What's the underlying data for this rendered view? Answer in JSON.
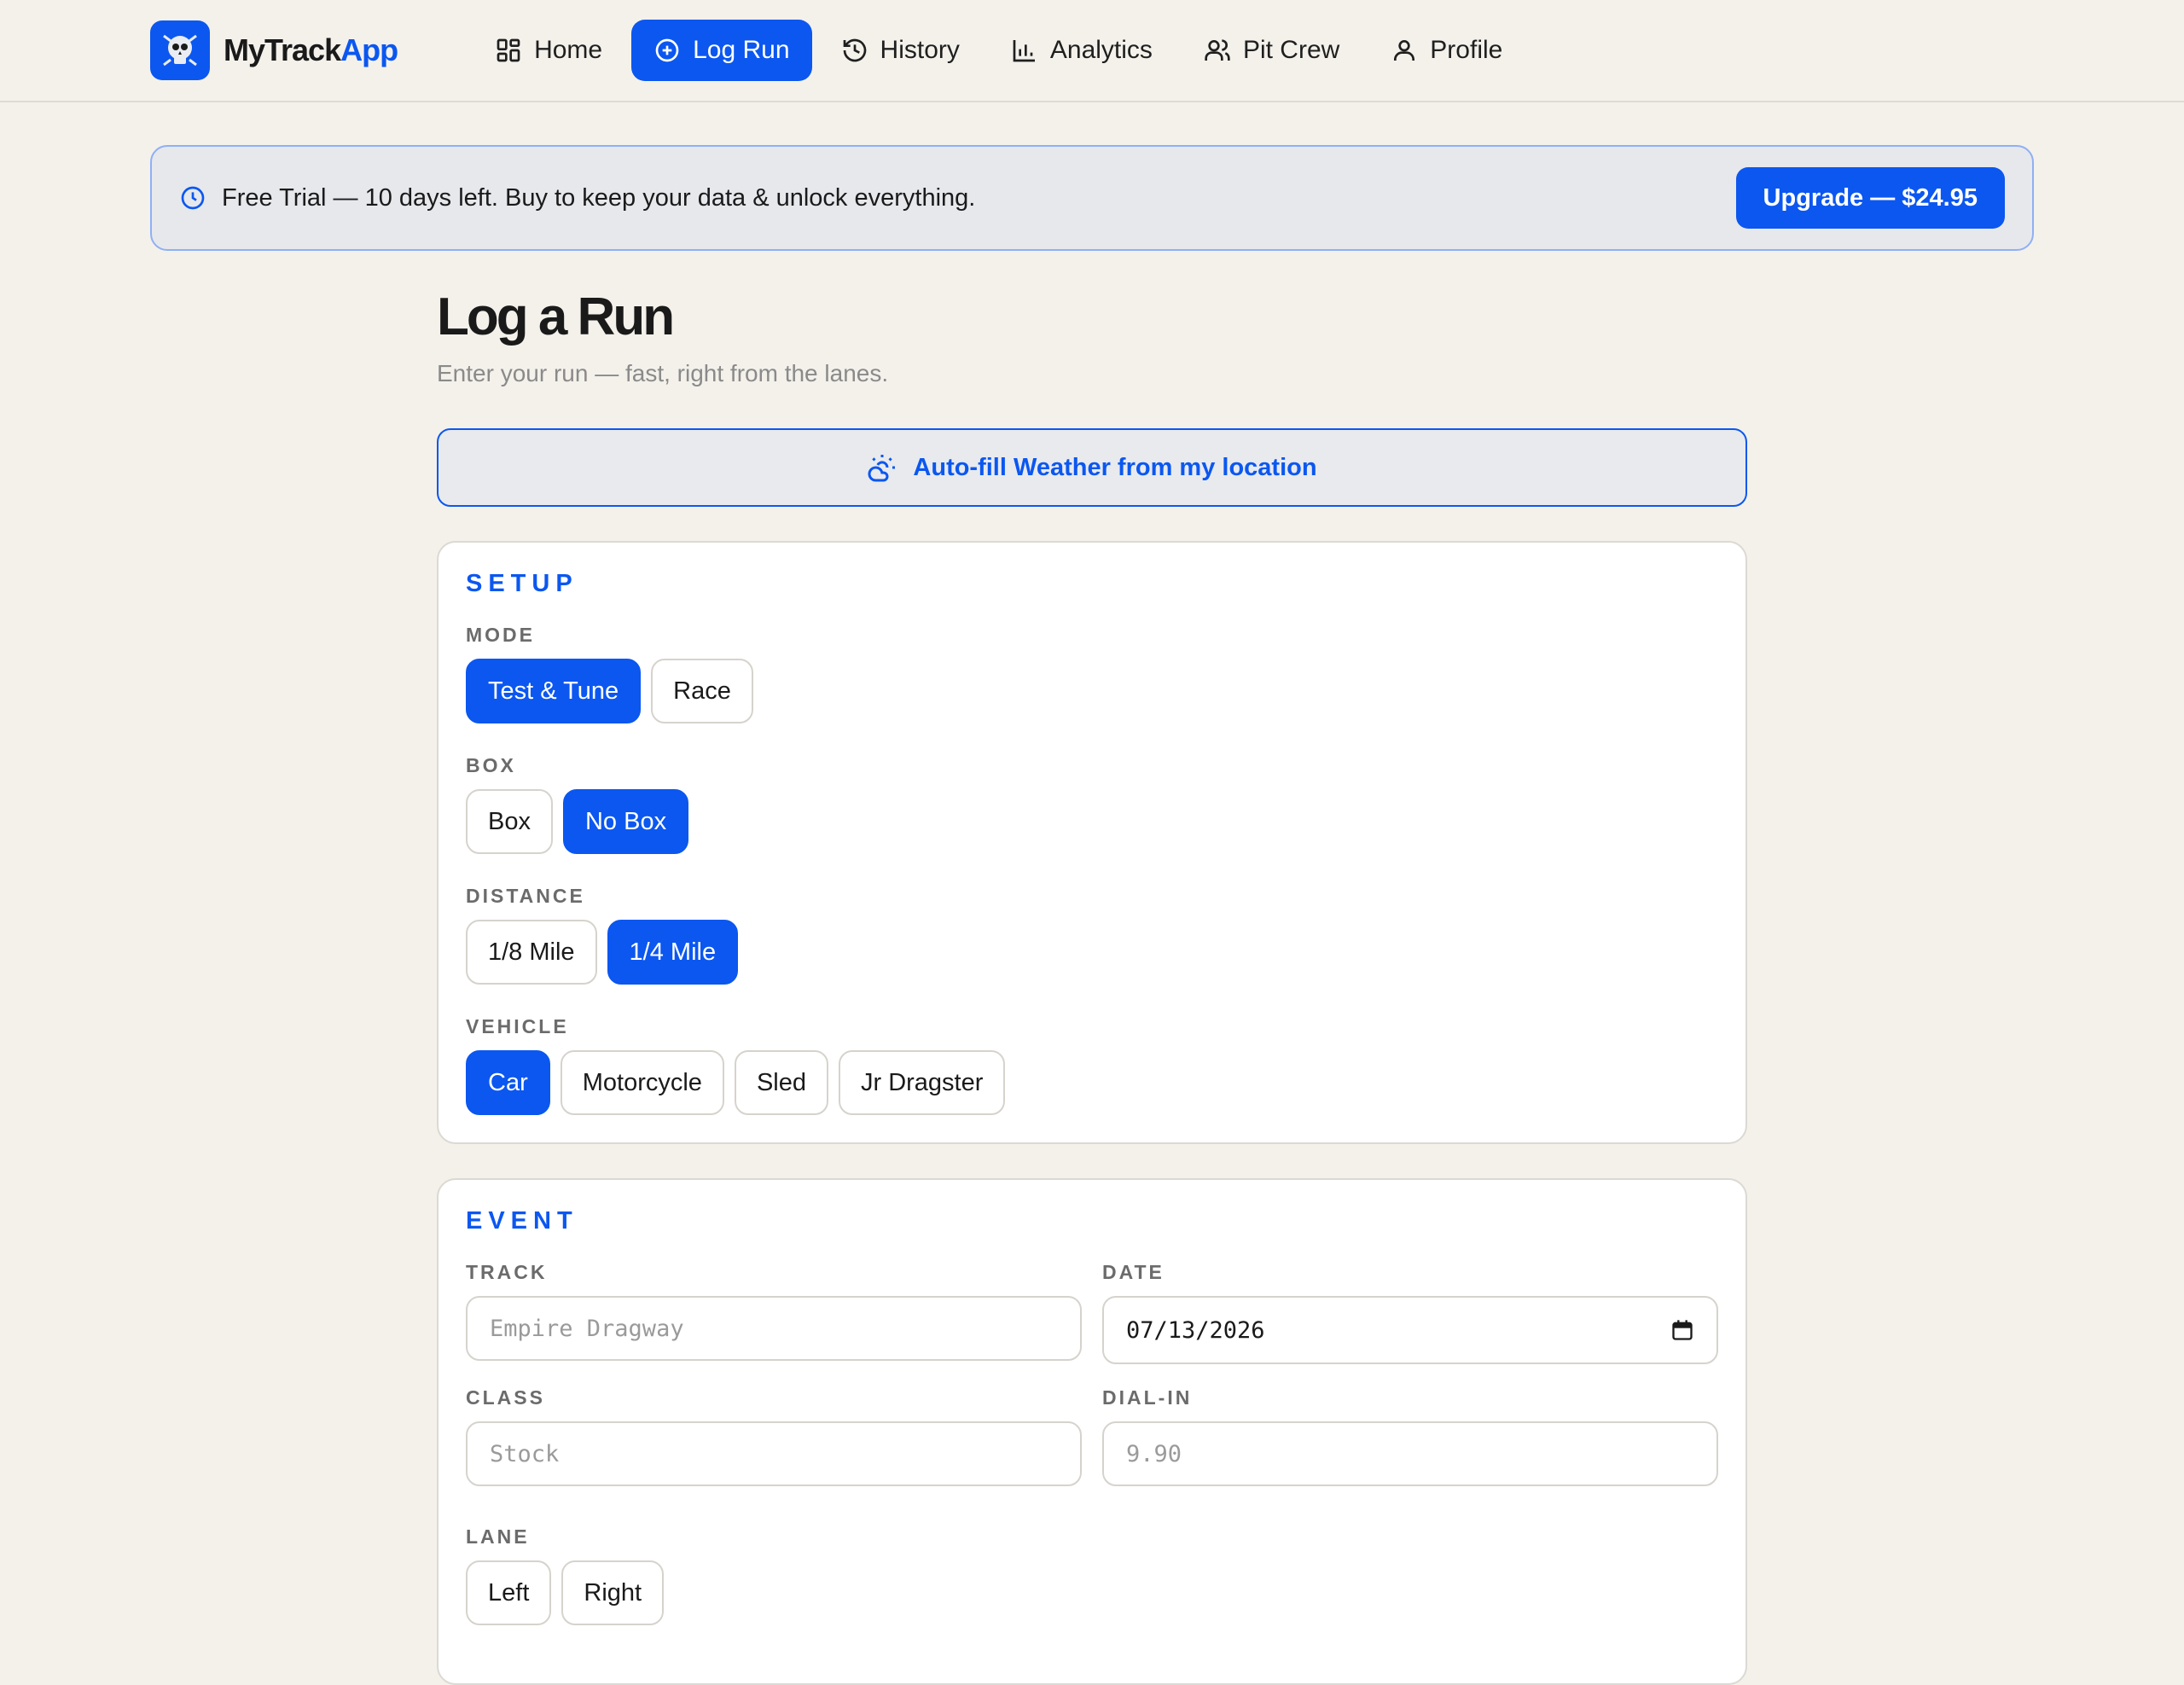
{
  "brand": {
    "name_main": "MyTrack",
    "name_accent": "App"
  },
  "nav": {
    "items": [
      {
        "label": "Home",
        "icon": "grid-icon"
      },
      {
        "label": "Log Run",
        "icon": "plus-circle-icon",
        "active": true
      },
      {
        "label": "History",
        "icon": "history-icon"
      },
      {
        "label": "Analytics",
        "icon": "bar-chart-icon"
      },
      {
        "label": "Pit Crew",
        "icon": "users-icon"
      },
      {
        "label": "Profile",
        "icon": "user-icon"
      }
    ]
  },
  "banner": {
    "text": "Free Trial — 10 days left. Buy to keep your data & unlock everything.",
    "upgrade_label": "Upgrade — $24.95"
  },
  "page": {
    "title": "Log a Run",
    "subtitle": "Enter your run — fast, right from the lanes."
  },
  "weather_button": {
    "label": "Auto-fill Weather from my location",
    "icon": "weather-icon"
  },
  "setup": {
    "title": "SETUP",
    "mode": {
      "label": "MODE",
      "options": [
        "Test & Tune",
        "Race"
      ],
      "selected": "Test & Tune"
    },
    "box": {
      "label": "BOX",
      "options": [
        "Box",
        "No Box"
      ],
      "selected": "No Box"
    },
    "distance": {
      "label": "DISTANCE",
      "options": [
        "1/8 Mile",
        "1/4 Mile"
      ],
      "selected": "1/4 Mile"
    },
    "vehicle": {
      "label": "VEHICLE",
      "options": [
        "Car",
        "Motorcycle",
        "Sled",
        "Jr Dragster"
      ],
      "selected": "Car"
    }
  },
  "event": {
    "title": "EVENT",
    "track": {
      "label": "TRACK",
      "placeholder": "Empire Dragway"
    },
    "date": {
      "label": "DATE",
      "value": "07/13/2026"
    },
    "class": {
      "label": "CLASS",
      "placeholder": "Stock"
    },
    "dial_in": {
      "label": "DIAL-IN",
      "placeholder": "9.90"
    },
    "lane": {
      "label": "LANE",
      "options": [
        "Left",
        "Right"
      ]
    }
  },
  "colors": {
    "accent": "#0b57f0",
    "background": "#f4f1eb"
  }
}
